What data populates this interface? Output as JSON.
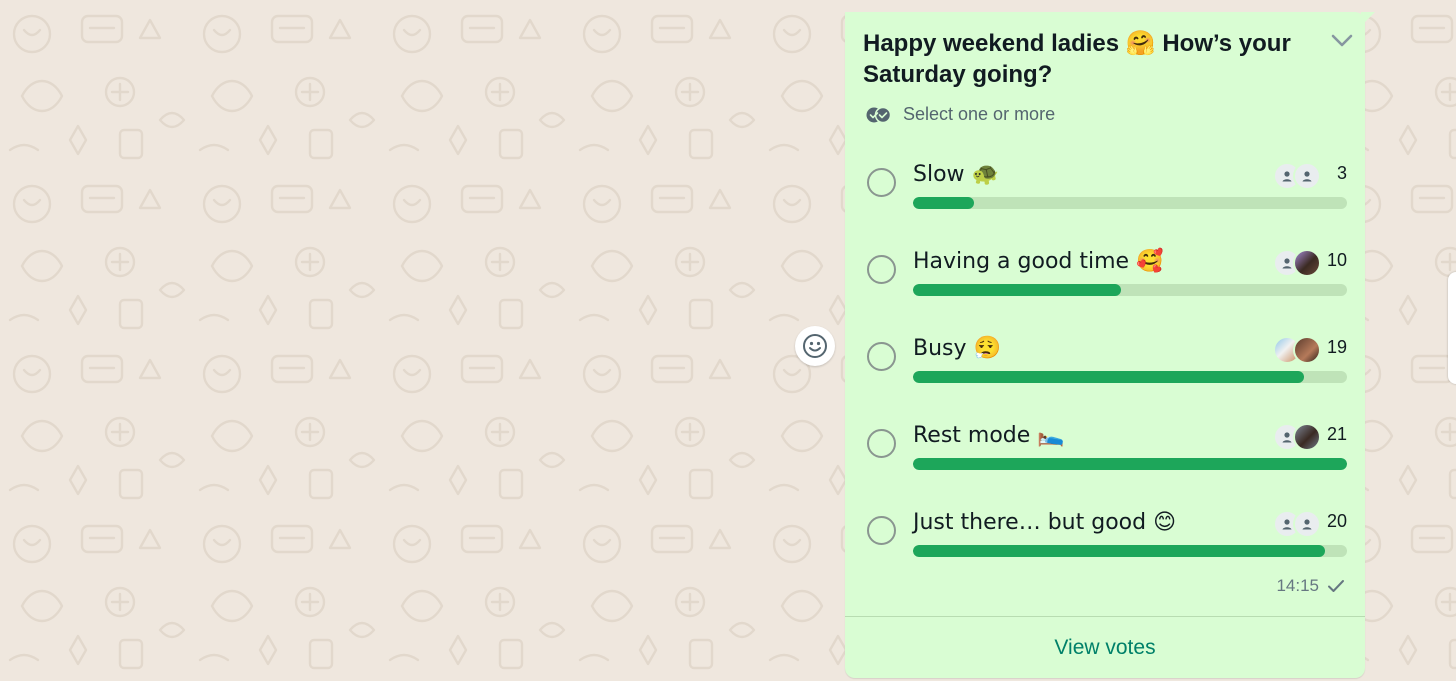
{
  "poll": {
    "title": "Happy weekend ladies 🤗 How’s your Saturday going?",
    "hint": "Select one or more",
    "options": [
      {
        "label": "Slow 🐢",
        "votes": "3",
        "fill": 0.14,
        "avatars": [
          "person-icon",
          "person-icon"
        ]
      },
      {
        "label": "Having a good time 🥰",
        "votes": "10",
        "fill": 0.48,
        "avatars": [
          "person-icon",
          "avatar-photo-1"
        ]
      },
      {
        "label": "Busy 😮‍💨",
        "votes": "19",
        "fill": 0.9,
        "avatars": [
          "avatar-photo-2",
          "avatar-photo-3"
        ]
      },
      {
        "label": "Rest mode 🛌",
        "votes": "21",
        "fill": 1.0,
        "avatars": [
          "person-icon",
          "avatar-photo-4"
        ]
      },
      {
        "label": "Just there… but good 😊",
        "votes": "20",
        "fill": 0.95,
        "avatars": [
          "person-icon",
          "person-icon"
        ]
      }
    ],
    "time": "14:15",
    "status_icon": "check-icon",
    "view_votes_label": "View votes"
  },
  "colors": {
    "chat_background": "#efe7de",
    "bubble": "#d9fdd3",
    "progress_fill": "#1da65a",
    "progress_track": "#bfe3b8",
    "link": "#008069"
  }
}
